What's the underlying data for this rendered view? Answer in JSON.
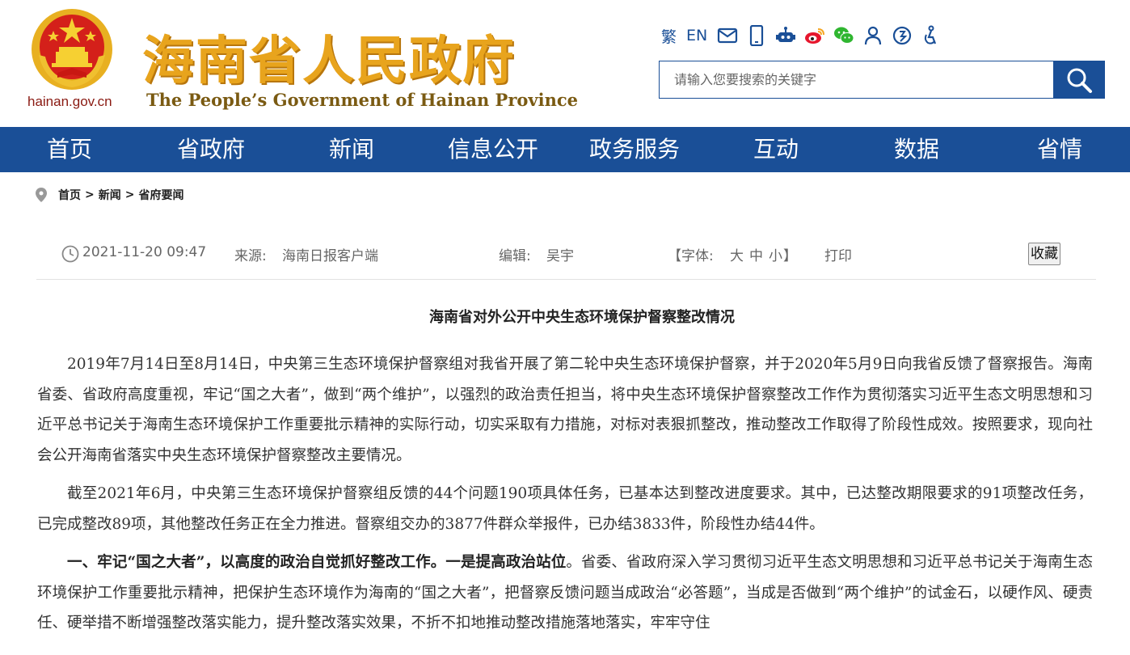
{
  "header": {
    "domain": "hainan.gov.cn",
    "title": "海南省人民政府",
    "subtitle": "The People’s Government  of Hainan Province",
    "tools": {
      "traditional": "繁",
      "english": "EN"
    },
    "search": {
      "placeholder": "请输入您要搜索的关键字"
    },
    "colors": {
      "brand_blue": "#1a4f97",
      "title_gold": "#e8a41d"
    }
  },
  "nav": {
    "items": [
      {
        "label": "首页"
      },
      {
        "label": "省政府"
      },
      {
        "label": "新闻"
      },
      {
        "label": "信息公开"
      },
      {
        "label": "政务服务"
      },
      {
        "label": "互动"
      },
      {
        "label": "数据"
      },
      {
        "label": "省情"
      }
    ]
  },
  "breadcrumb": {
    "items": [
      "首页",
      "新闻",
      "省府要闻"
    ],
    "separator": ">"
  },
  "meta": {
    "datetime": "2021-11-20 09:47",
    "source_label": "来源:",
    "source": "海南日报客户端",
    "editor_label": "编辑:",
    "editor": "吴宇",
    "font_open": "【字体:",
    "font_large": "大",
    "font_medium": "中",
    "font_small": "小",
    "font_close": "】",
    "print": "打印",
    "favorite": "收藏"
  },
  "article": {
    "title": "海南省对外公开中央生态环境保护督察整改情况",
    "p1": "2019年7月14日至8月14日，中央第三生态环境保护督察组对我省开展了第二轮中央生态环境保护督察，并于2020年5月9日向我省反馈了督察报告。海南省委、省政府高度重视，牢记“国之大者”，做到“两个维护”，以强烈的政治责任担当，将中央生态环境保护督察整改工作作为贯彻落实习近平生态文明思想和习近平总书记关于海南生态环境保护工作重要批示精神的实际行动，切实采取有力措施，对标对表狠抓整改，推动整改工作取得了阶段性成效。按照要求，现向社会公开海南省落实中央生态环境保护督察整改主要情况。",
    "p2": "截至2021年6月，中央第三生态环境保护督察组反馈的44个问题190项具体任务，已基本达到整改进度要求。其中，已达整改期限要求的91项整改任务，已完成整改89项，其他整改任务正在全力推进。督察组交办的3877件群众举报件，已办结3833件，阶段性办结44件。",
    "p3_bold": "一、牢记“国之大者”，以高度的政治自觉抓好整改工作。一是提高政治站位",
    "p3_rest": "。省委、省政府深入学习贯彻习近平生态文明思想和习近平总书记关于海南生态环境保护工作重要批示精神，把保护生态环境作为海南的“国之大者”，把督察反馈问题当成政治“必答题”，当成是否做到“两个维护”的试金石，以硬作风、硬责任、硬举措不断增强整改落实能力，提升整改落实效果，不折不扣地推动整改措施落地落实，牢牢守住"
  }
}
